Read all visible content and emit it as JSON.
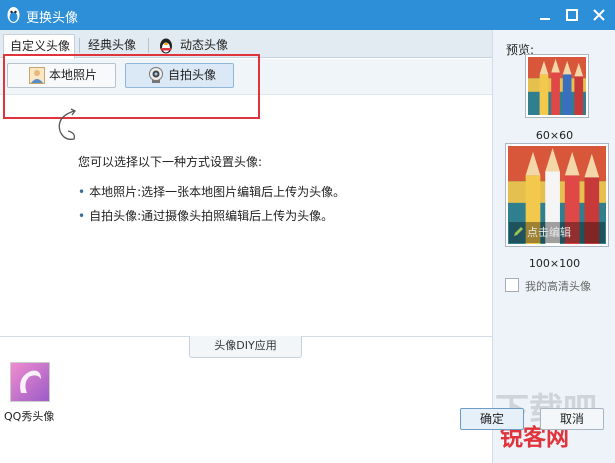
{
  "window": {
    "title": "更换头像"
  },
  "tabs": [
    {
      "label": "自定义头像",
      "active": true
    },
    {
      "label": "经典头像",
      "active": false
    },
    {
      "label": "动态头像",
      "active": false
    }
  ],
  "source_buttons": [
    {
      "label": "本地照片",
      "active": false,
      "icon": "person-photo-icon"
    },
    {
      "label": "自拍头像",
      "active": true,
      "icon": "webcam-icon"
    }
  ],
  "hints": {
    "title": "您可以选择以下一种方式设置头像:",
    "items": [
      "本地照片:选择一张本地图片编辑后上传为头像。",
      "自拍头像:通过摄像头拍照编辑后上传为头像。"
    ]
  },
  "diy": {
    "tab_label": "头像DIY应用",
    "apps": [
      {
        "label": "QQ秀头像"
      }
    ]
  },
  "preview": {
    "label": "预览:",
    "small_size": "60×60",
    "large_size": "100×100",
    "edit_label": "点击编辑",
    "hd_label": "我的高清头像"
  },
  "footer": {
    "ok_label": "确定",
    "cancel_label": "取消"
  },
  "watermark": {
    "line1": "下载吧",
    "line2": "锐客网"
  },
  "colors": {
    "titlebar": "#2d8fd8",
    "highlight": "#e0343c",
    "accent": "#3a6f98"
  }
}
